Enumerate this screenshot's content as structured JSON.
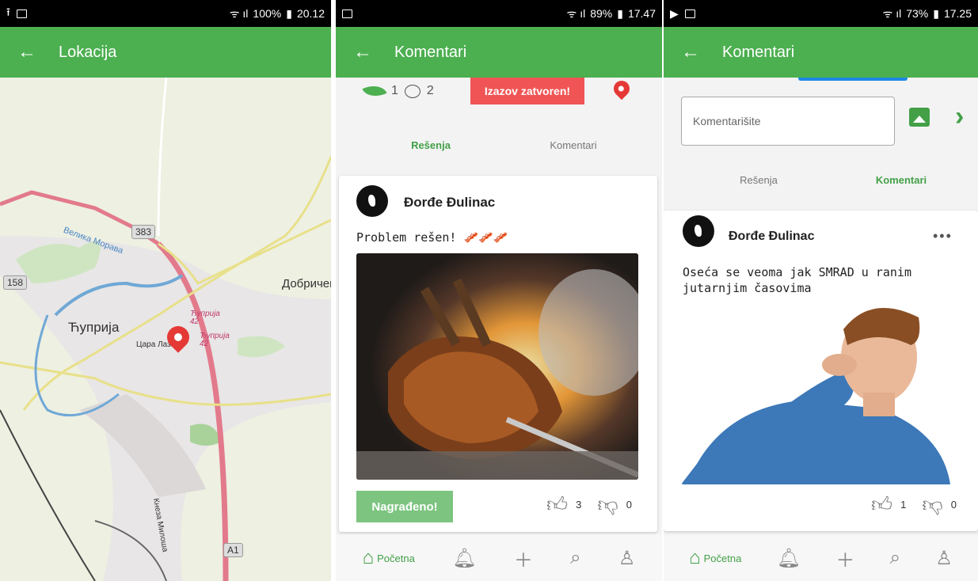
{
  "screens": [
    {
      "status": {
        "left": "⭱",
        "battery": "100%",
        "time": "20.12"
      },
      "title": "Lokacija",
      "map": {
        "city": "Ћуприја",
        "town_right": "Добричев",
        "road_383": "383",
        "road_158": "158",
        "road_a1": "A1",
        "river": "Велика Морава",
        "label_cupr1": "Ћуприја\n42",
        "label_cupr2": "Ћуприја\n42",
        "street": "Цара Лаза",
        "street2": "Кнеза Милоша"
      }
    },
    {
      "status": {
        "battery": "89%",
        "time": "17.47"
      },
      "title": "Komentari",
      "stats": {
        "likes": "1",
        "comments": "2"
      },
      "closed_label": "Izazov zatvoren!",
      "tabs": {
        "solutions": "Rešenja",
        "comments": "Komentari"
      },
      "post": {
        "author": "Đorđe Đulinac",
        "text": "Problem rešen! 🥓🥓🥓",
        "award": "Nagrađeno!",
        "upvotes": "3",
        "downvotes": "0"
      },
      "nav": {
        "home": "Početna"
      }
    },
    {
      "status": {
        "battery": "73%",
        "time": "17.25"
      },
      "title": "Komentari",
      "comment_placeholder": "Komentarišite",
      "tabs": {
        "solutions": "Rešenja",
        "comments": "Komentari"
      },
      "post": {
        "author": "Đorđe Đulinac",
        "text": "Oseća se veoma jak SMRAD u ranim jutarnjim časovima",
        "upvotes": "1",
        "downvotes": "0"
      },
      "nav": {
        "home": "Početna"
      }
    }
  ],
  "colors": {
    "primary": "#4caf50",
    "danger": "#f05454",
    "award": "#7cc47f"
  }
}
